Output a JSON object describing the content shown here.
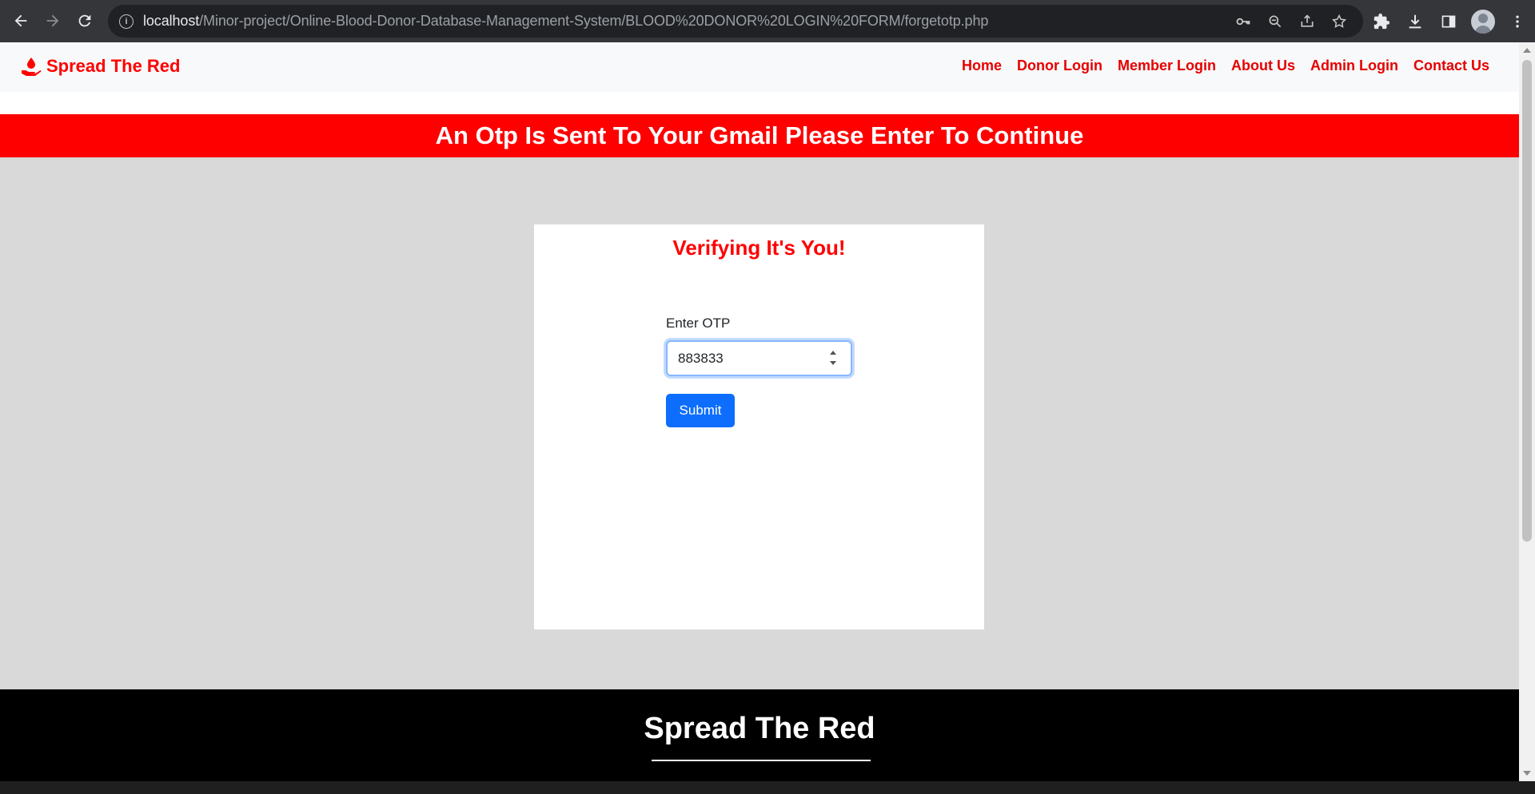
{
  "browser": {
    "url_host": "localhost",
    "url_path": "/Minor-project/Online-Blood-Donor-Database-Management-System/BLOOD%20DONOR%20LOGIN%20FORM/forgetotp.php"
  },
  "site": {
    "brand": "Spread The Red",
    "nav": [
      {
        "label": "Home"
      },
      {
        "label": "Donor Login"
      },
      {
        "label": "Member Login"
      },
      {
        "label": "About Us"
      },
      {
        "label": "Admin Login"
      },
      {
        "label": "Contact Us"
      }
    ],
    "banner_text": "An Otp Is Sent To Your Gmail Please Enter To Continue"
  },
  "form": {
    "title": "Verifying It's You!",
    "otp_label": "Enter OTP",
    "otp_value": "883833",
    "submit_label": "Submit"
  },
  "footer": {
    "title": "Spread The Red"
  },
  "colors": {
    "brand_red": "#ff0000",
    "primary_blue": "#0d6efd",
    "page_bg": "#d9d9d9"
  }
}
